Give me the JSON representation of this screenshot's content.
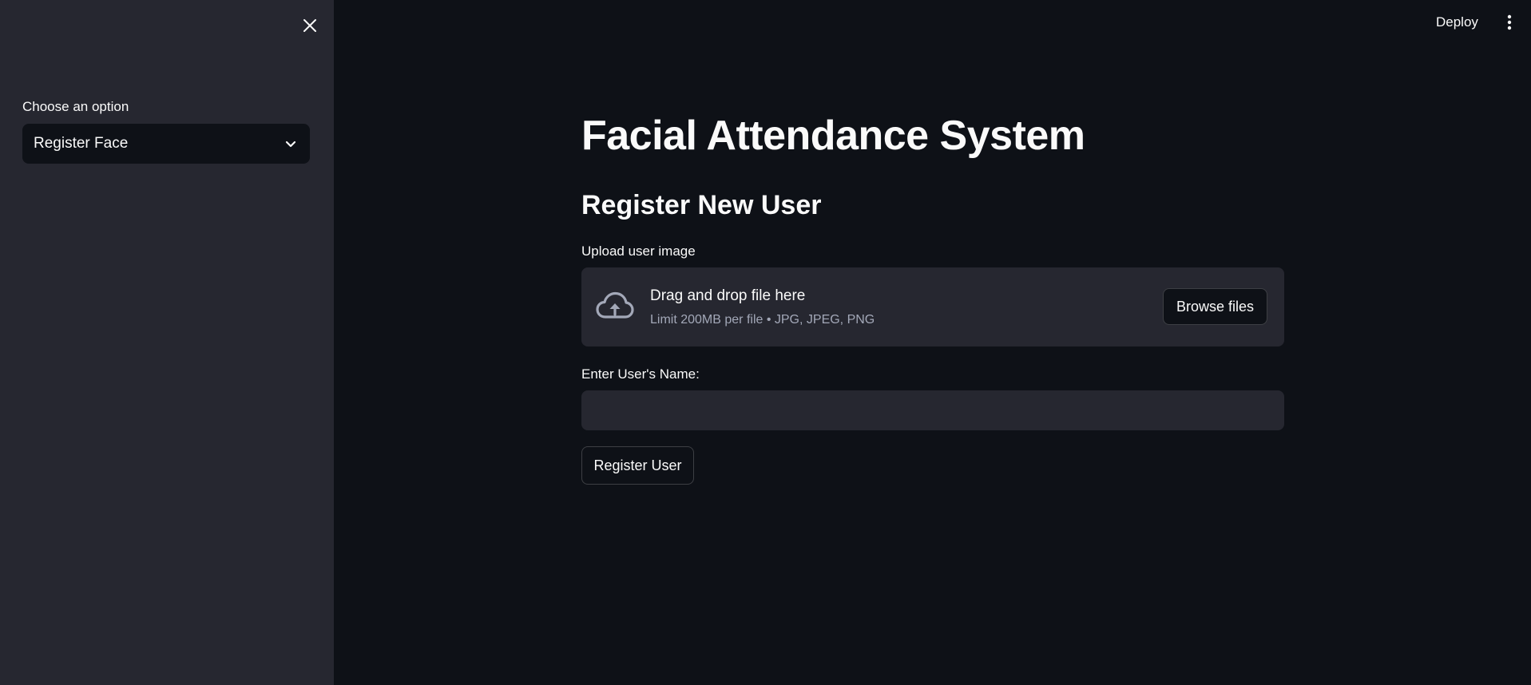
{
  "theme": {
    "background": "#0e1117",
    "sidebar_background": "#262730",
    "text": "#fafafa",
    "muted_text": "#a3a8b8"
  },
  "header": {
    "deploy_label": "Deploy",
    "menu_icon": "kebab-menu-icon"
  },
  "sidebar": {
    "close_icon": "close-icon",
    "select_label": "Choose an option",
    "select_value": "Register Face",
    "select_icon": "chevron-down-icon"
  },
  "main": {
    "title": "Facial Attendance System",
    "section_title": "Register New User",
    "upload": {
      "label": "Upload user image",
      "icon": "cloud-upload-icon",
      "drop_text": "Drag and drop file here",
      "limit_text": "Limit 200MB per file • JPG, JPEG, PNG",
      "browse_label": "Browse files"
    },
    "name_field": {
      "label": "Enter User's Name:",
      "value": "",
      "placeholder": ""
    },
    "register_button_label": "Register User"
  }
}
